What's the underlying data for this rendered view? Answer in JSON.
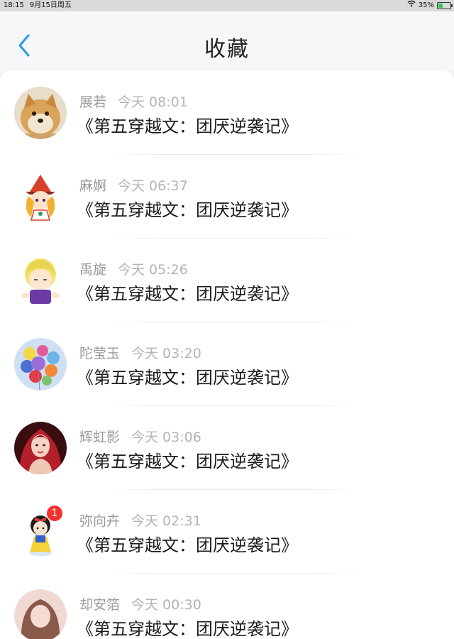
{
  "status_bar": {
    "time": "18:15",
    "date": "9月15日周五",
    "battery_percent": "35%",
    "battery_level": 0.35,
    "wifi_icon": "wifi-icon",
    "battery_icon": "battery-charging-icon"
  },
  "header": {
    "title": "收藏",
    "back_icon": "chevron-left-icon",
    "accent_color": "#2f9ee8"
  },
  "favorites": [
    {
      "name": "展若",
      "time": "今天 08:01",
      "title": "《第五穿越文：团厌逆袭记》",
      "avatar": "shiba-dog"
    },
    {
      "name": "麻婀",
      "time": "今天 06:37",
      "title": "《第五穿越文：团厌逆袭记》",
      "avatar": "witch-girl"
    },
    {
      "name": "禹旋",
      "time": "今天 05:26",
      "title": "《第五穿越文：团厌逆袭记》",
      "avatar": "blonde-cartoon"
    },
    {
      "name": "陀莹玉",
      "time": "今天 03:20",
      "title": "《第五穿越文：团厌逆袭记》",
      "avatar": "balloons"
    },
    {
      "name": "辉虹影",
      "time": "今天 03:06",
      "title": "《第五穿越文：团厌逆袭记》",
      "avatar": "red-hair-woman"
    },
    {
      "name": "弥向卉",
      "time": "今天 02:31",
      "title": "《第五穿越文：团厌逆袭记》",
      "avatar": "snow-white",
      "badge": "1"
    },
    {
      "name": "却安箔",
      "time": "今天 00:30",
      "title": "《第五穿越文：团厌逆袭记》",
      "avatar": "woman-photo"
    }
  ]
}
